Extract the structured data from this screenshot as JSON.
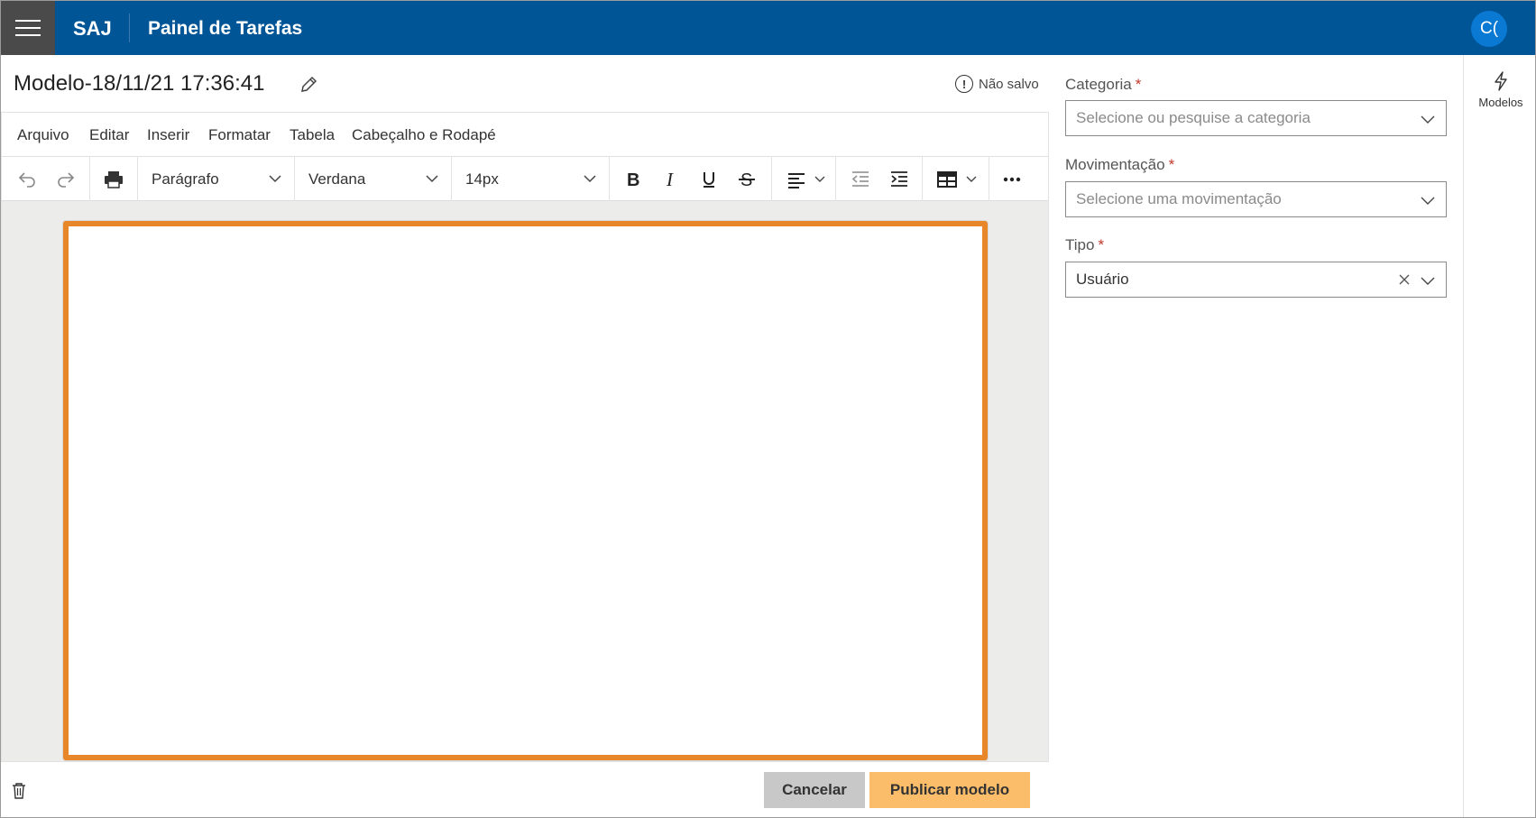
{
  "header": {
    "brand": "SAJ",
    "app_title": "Painel de Tarefas",
    "avatar_initials": "C("
  },
  "document": {
    "title": "Modelo-18/11/21 17:36:41",
    "status": "Não salvo"
  },
  "editor": {
    "menu": [
      "Arquivo",
      "Editar",
      "Inserir",
      "Formatar",
      "Tabela",
      "Cabeçalho e Rodapé"
    ],
    "block_format": "Parágrafo",
    "font_family": "Verdana",
    "font_size": "14px",
    "page_border_color": "#e8862a"
  },
  "form": {
    "categoria": {
      "label": "Categoria",
      "required_mark": "*",
      "placeholder": "Selecione ou pesquise a categoria"
    },
    "movimentacao": {
      "label": "Movimentação",
      "required_mark": "*",
      "placeholder": "Selecione uma movimentação"
    },
    "tipo": {
      "label": "Tipo",
      "required_mark": "*",
      "value": "Usuário"
    }
  },
  "actions": {
    "cancel_label": "Cancelar",
    "publish_label": "Publicar modelo"
  },
  "rail": {
    "models_label": "Modelos",
    "models_icon": "lightning-icon"
  },
  "colors": {
    "header_bg": "#005596",
    "publish_bg": "#fbbd6a",
    "cancel_bg": "#c8c8c8",
    "required": "#c0392b"
  }
}
